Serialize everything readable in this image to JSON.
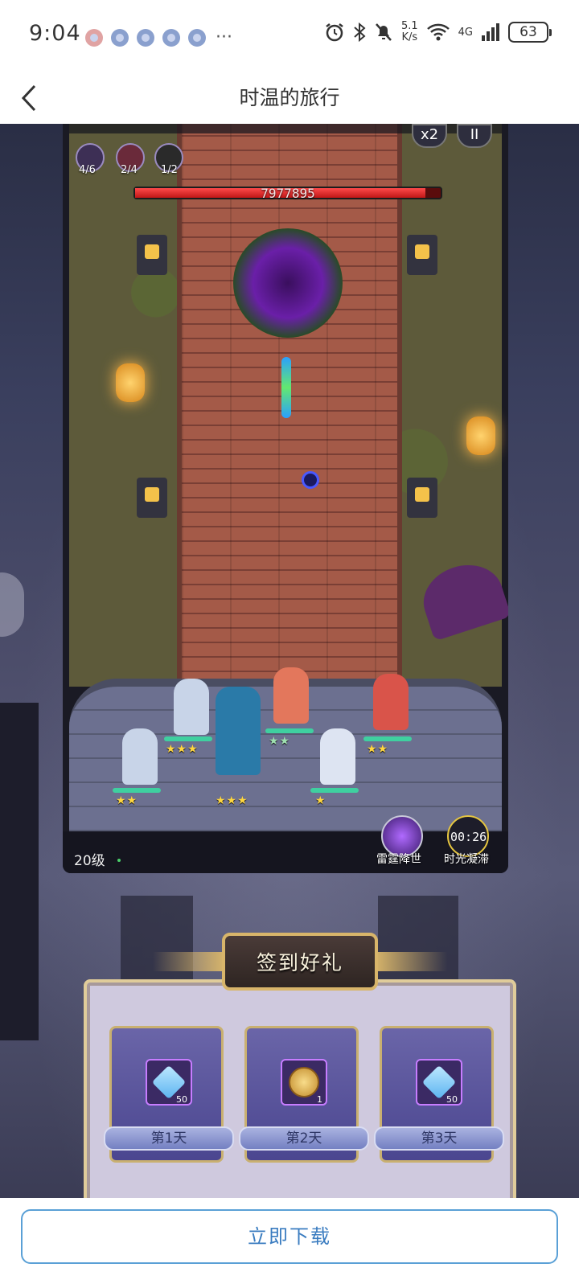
{
  "status_bar": {
    "time": "9:04",
    "more": "···",
    "speed_value": "5.1",
    "speed_unit": "K/s",
    "network": "4G",
    "battery": "63"
  },
  "header": {
    "title": "时温的旅行"
  },
  "game": {
    "boss_hp": "7977895",
    "boss_hp_fraction": 0.95,
    "skills": [
      {
        "count": "4/6"
      },
      {
        "count": "2/4"
      },
      {
        "count": "1/2"
      }
    ],
    "speed_button": "x2",
    "pause_button": "II",
    "level": "20级",
    "ult_skills": [
      {
        "label": "雷霆降世"
      },
      {
        "label": "时光凝滞",
        "timer": "00:26"
      }
    ],
    "hero_stars": [
      "★★★",
      "★★",
      "★★",
      "★★",
      "★",
      "★★★",
      "★★"
    ]
  },
  "signin": {
    "title": "签到好礼",
    "rewards": [
      {
        "day": "第1天",
        "qty": "50",
        "icon": "diamond-icon"
      },
      {
        "day": "第2天",
        "qty": "1",
        "icon": "coin-icon"
      },
      {
        "day": "第3天",
        "qty": "50",
        "icon": "diamond-icon"
      }
    ]
  },
  "download_button": "立即下载",
  "colors": {
    "accent": "#3a7cc0",
    "boss_bar": "#c01818"
  }
}
